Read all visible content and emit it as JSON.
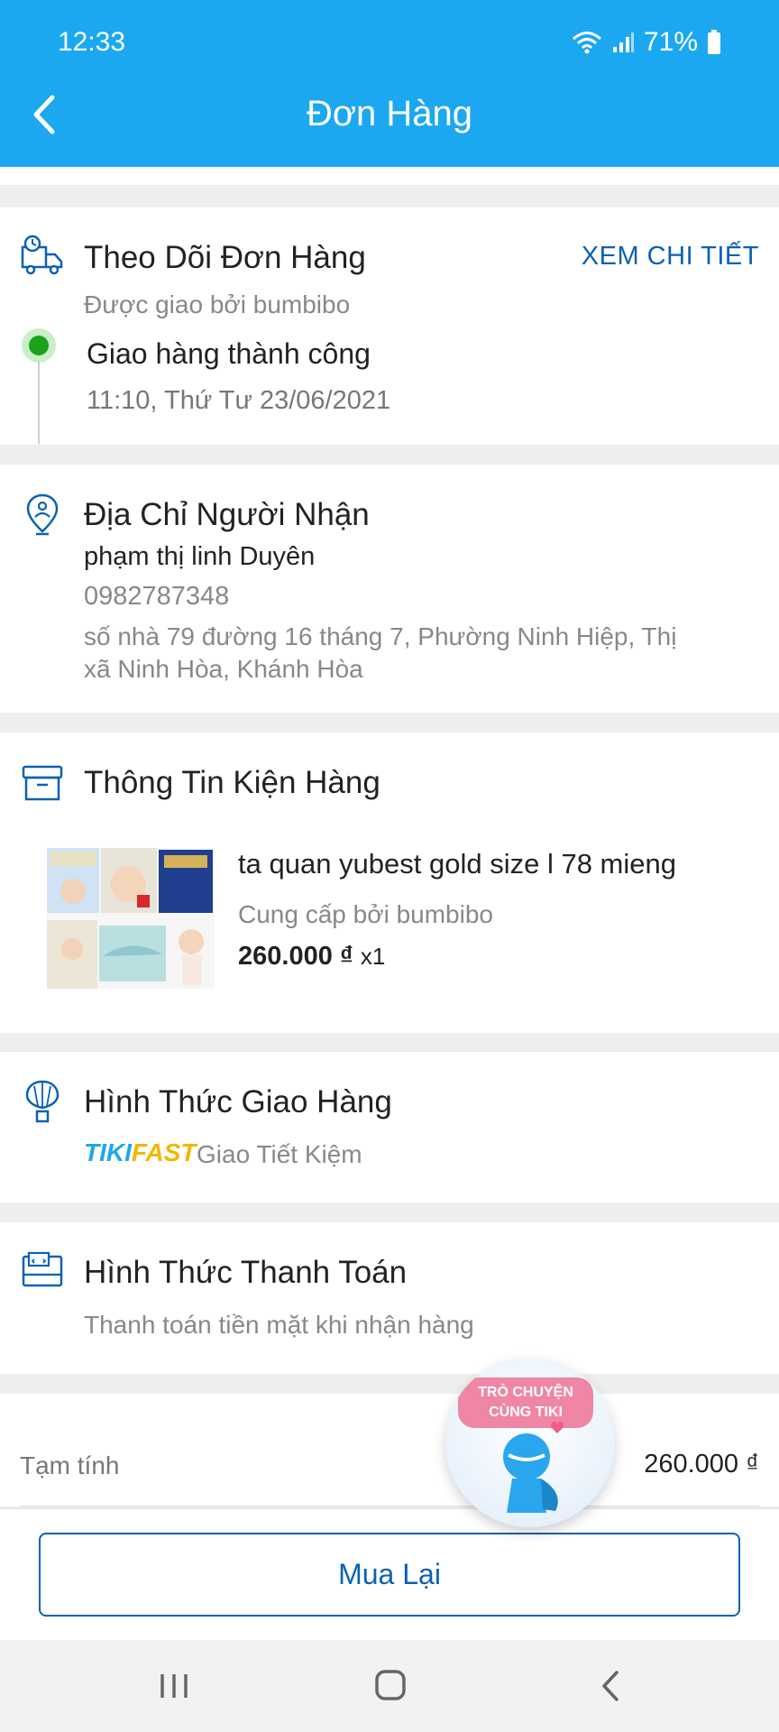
{
  "status_bar": {
    "time": "12:33",
    "battery": "71%"
  },
  "header": {
    "title": "Đơn Hàng"
  },
  "tracking": {
    "title": "Theo Dõi Đơn Hàng",
    "link_label": "XEM CHI TIẾT",
    "delivered_by": "Được giao bởi bumbibo",
    "status": "Giao hàng thành công",
    "timestamp": "11:10, Thứ Tư 23/06/2021"
  },
  "address": {
    "title": "Địa Chỉ Người Nhận",
    "name": "phạm thị linh Duyên",
    "phone": "0982787348",
    "line1": "số nhà 79 đường 16 tháng 7, Phường Ninh Hiệp, Thị",
    "line2": "xã Ninh Hòa, Khánh Hòa"
  },
  "package": {
    "title": "Thông Tin Kiện Hàng",
    "product_name": "ta quan yubest gold size l 78 mieng",
    "seller": "Cung cấp bởi bumbibo",
    "price": "260.000 ₫",
    "quantity": "x1"
  },
  "shipping": {
    "title": "Hình Thức Giao Hàng",
    "brand_part1": "TIKI",
    "brand_part2": "FAST",
    "method": "Giao Tiết Kiệm"
  },
  "payment": {
    "title": "Hình Thức Thanh Toán",
    "method": "Thanh toán tiền mặt khi nhận hàng"
  },
  "summary": {
    "subtotal_label": "Tạm tính",
    "subtotal_value": "260.000 ₫"
  },
  "chat_bubble": {
    "line1": "TRÒ CHUYỆN",
    "line2": "CÙNG TIKI"
  },
  "actions": {
    "rebuy_label": "Mua Lại"
  },
  "colors": {
    "header_blue": "#1ba8f0",
    "link_blue": "#0b61b4",
    "success_green": "#1aa31a"
  },
  "icons": [
    "back-arrow-icon",
    "wifi-icon",
    "signal-icon",
    "battery-icon",
    "truck-icon",
    "location-pin-icon",
    "package-box-icon",
    "balloon-delivery-icon",
    "payment-icon",
    "recent-apps-icon",
    "home-icon",
    "nav-back-icon"
  ]
}
